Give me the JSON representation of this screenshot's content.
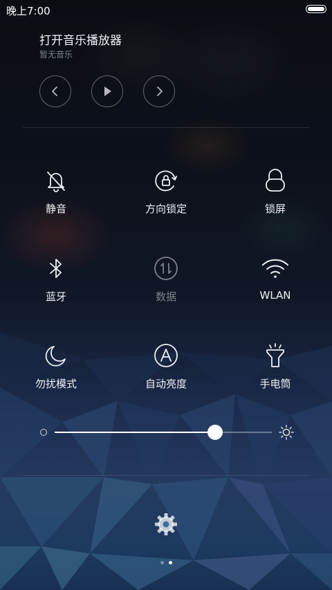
{
  "status_bar": {
    "time": "晚上7:00",
    "battery_level": 1.0
  },
  "music": {
    "title": "打开音乐播放器",
    "subtitle": "暂无音乐",
    "controls": [
      "prev-icon",
      "play-icon",
      "next-icon"
    ]
  },
  "tiles": [
    {
      "key": "mute",
      "label": "静音",
      "icon": "bell-off-icon",
      "active": true
    },
    {
      "key": "rotation-lock",
      "label": "方向锁定",
      "icon": "rotation-lock-icon",
      "active": true
    },
    {
      "key": "lock-screen",
      "label": "锁屏",
      "icon": "lock-icon",
      "active": true
    },
    {
      "key": "bluetooth",
      "label": "蓝牙",
      "icon": "bluetooth-icon",
      "active": true
    },
    {
      "key": "data",
      "label": "数据",
      "icon": "mobile-data-icon",
      "active": false
    },
    {
      "key": "wlan",
      "label": "WLAN",
      "icon": "wifi-icon",
      "active": true
    },
    {
      "key": "dnd",
      "label": "勿扰模式",
      "icon": "moon-icon",
      "active": true
    },
    {
      "key": "auto-brightness",
      "label": "自动亮度",
      "icon": "auto-brightness-icon",
      "active": true
    },
    {
      "key": "flashlight",
      "label": "手电筒",
      "icon": "flashlight-icon",
      "active": true
    }
  ],
  "brightness": {
    "level": 0.74
  },
  "settings_icon": "gear-icon",
  "pager": {
    "pages": 2,
    "current": 2
  },
  "colors": {
    "text": "#eef1f6",
    "text_dim": "#7c828d",
    "accent": "#ffffff"
  }
}
